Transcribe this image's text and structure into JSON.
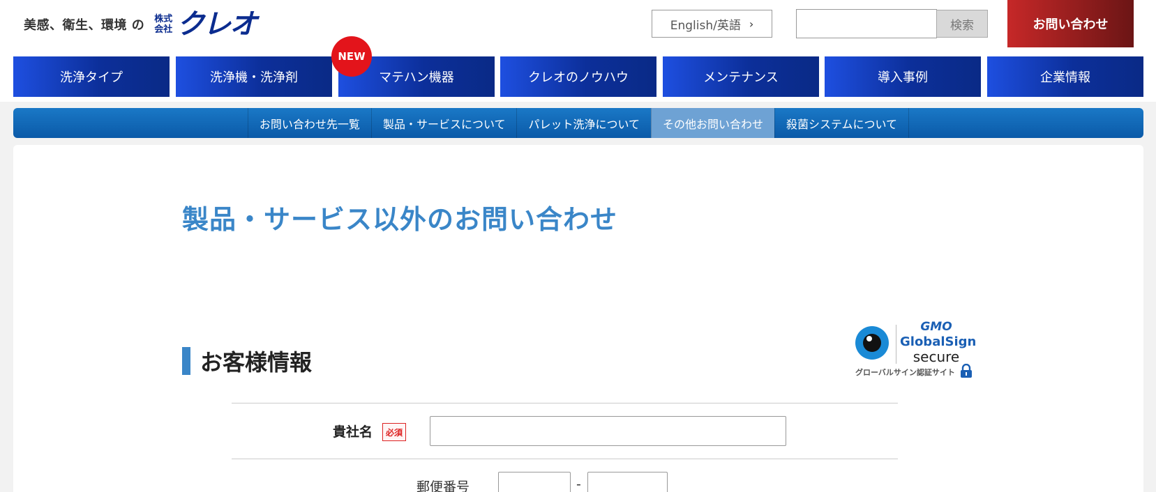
{
  "header": {
    "logo_tagline": "美感、衛生、環境 の",
    "logo_kk_top": "株式",
    "logo_kk_bottom": "会社",
    "logo_name": "クレオ",
    "lang_label": "English/英語",
    "search_placeholder": "",
    "search_button": "検索",
    "contact_button": "お問い合わせ"
  },
  "gnav": {
    "new_badge": "NEW",
    "items": [
      {
        "label": "洗浄タイプ"
      },
      {
        "label": "洗浄機・洗浄剤"
      },
      {
        "label": "マテハン機器"
      },
      {
        "label": "クレオのノウハウ"
      },
      {
        "label": "メンテナンス"
      },
      {
        "label": "導入事例"
      },
      {
        "label": "企業情報"
      }
    ]
  },
  "subnav": {
    "items": [
      {
        "label": "お問い合わせ先一覧",
        "active": false
      },
      {
        "label": "製品・サービスについて",
        "active": false
      },
      {
        "label": "パレット洗浄について",
        "active": false
      },
      {
        "label": "その他お問い合わせ",
        "active": true
      },
      {
        "label": "殺菌システムについて",
        "active": false
      }
    ]
  },
  "main": {
    "page_title": "製品・サービス以外のお問い合わせ",
    "section_title": "お客様情報",
    "ssl": {
      "brand": "GMO",
      "name": "GlobalSign",
      "secure": "secure",
      "caption": "グローバルサイン認証サイト"
    },
    "form": {
      "company_label": "貴社名",
      "required_badge": "必須",
      "company_value": "",
      "postal_label": "郵便番号",
      "postal_dash": "-",
      "postal_first": "",
      "postal_second": ""
    }
  },
  "colors": {
    "brand_blue": "#0b2c8f",
    "accent_blue": "#3a86c8",
    "contact_red": "#c62828",
    "new_badge_red": "#e3141b"
  }
}
